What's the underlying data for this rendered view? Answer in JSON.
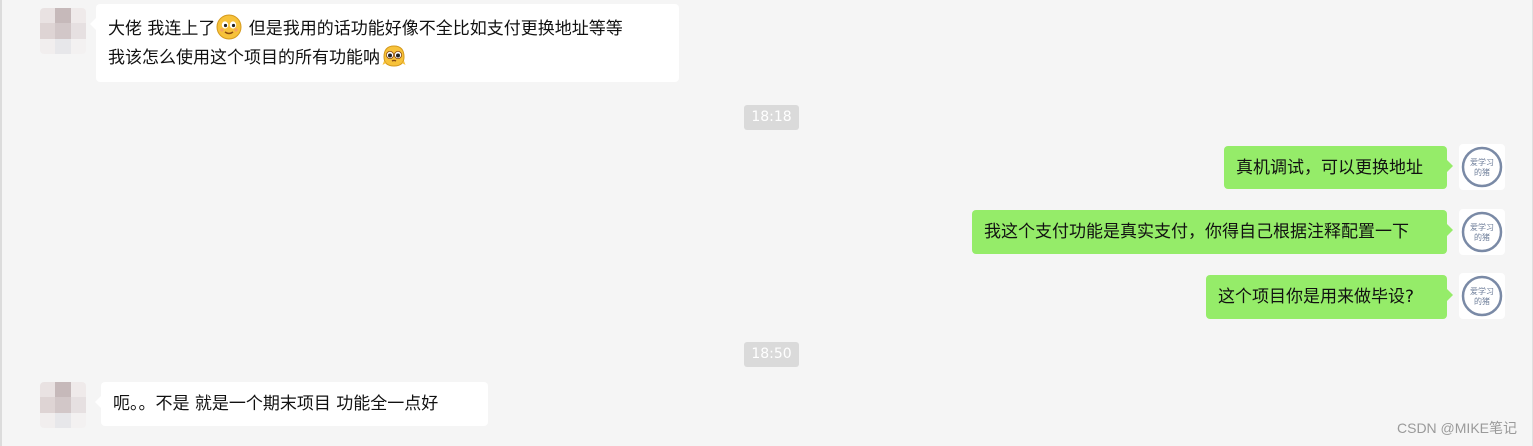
{
  "messages": [
    {
      "sender": "contact",
      "parts": [
        "大佬  我连上了",
        "  但是我用的话功能好像不全比如支付更换地址等等"
      ],
      "line2": "我该怎么使用这个项目的所有功能呐",
      "emojis": [
        "smiling-face-emoji",
        "pleading-face-emoji"
      ]
    },
    {
      "sender": "me",
      "text": "真机调试，可以更换地址"
    },
    {
      "sender": "me",
      "text": "我这个支付功能是真实支付，你得自己根据注释配置一下"
    },
    {
      "sender": "me",
      "text": "这个项目你是用来做毕设?"
    },
    {
      "sender": "contact",
      "text": "呃。。不是  就是一个期末项目   功能全一点好"
    }
  ],
  "timestamps": [
    "18:18",
    "18:50"
  ],
  "watermark": "CSDN @MIKE笔记",
  "colors": {
    "background": "#f5f5f5",
    "incoming_bubble": "#ffffff",
    "outgoing_bubble": "#95ec69",
    "timestamp_bg": "#dadada"
  }
}
